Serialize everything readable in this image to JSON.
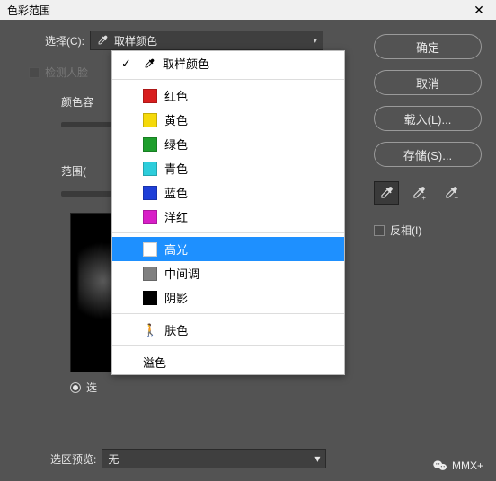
{
  "window": {
    "title": "色彩范围",
    "close": "✕"
  },
  "select": {
    "label": "选择(C):",
    "current": "取样颜色",
    "icon": "eyedropper-icon"
  },
  "dropdown": {
    "sampled": "取样颜色",
    "colors": {
      "red": {
        "label": "红色",
        "hex": "#d81e1e"
      },
      "yellow": {
        "label": "黄色",
        "hex": "#f5d90a"
      },
      "green": {
        "label": "绿色",
        "hex": "#1e9e2c"
      },
      "cyan": {
        "label": "青色",
        "hex": "#2dcddb"
      },
      "blue": {
        "label": "蓝色",
        "hex": "#1e3fd8"
      },
      "magenta": {
        "label": "洋红",
        "hex": "#d81ec7"
      }
    },
    "tones": {
      "highlights": {
        "label": "高光",
        "hex": "#ffffff"
      },
      "midtones": {
        "label": "中间调",
        "hex": "#808080"
      },
      "shadows": {
        "label": "阴影",
        "hex": "#000000"
      }
    },
    "skin": "肤色",
    "outofgamut": "溢色",
    "selected": "highlights",
    "checked": "sampled"
  },
  "left": {
    "detect_faces": "检测人脸",
    "fuzziness_label_partial": "颜色容",
    "range_label_partial": "范围(",
    "radio_label_partial": "选"
  },
  "right": {
    "ok": "确定",
    "cancel": "取消",
    "load": "载入(L)...",
    "save": "存储(S)...",
    "invert": "反相(I)"
  },
  "previewSelect": {
    "label": "选区预览:",
    "value": "无"
  },
  "watermark": "MMX+"
}
